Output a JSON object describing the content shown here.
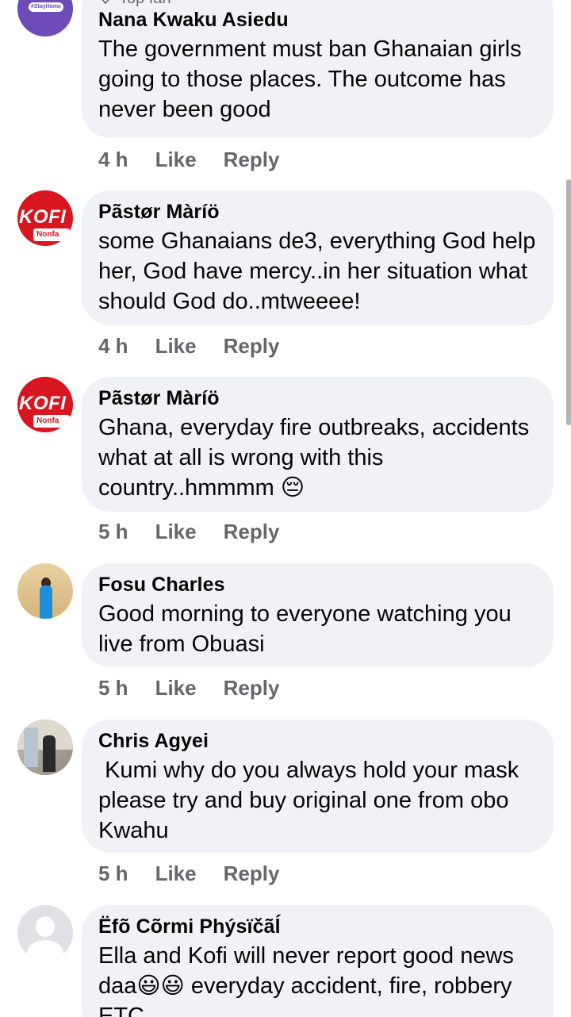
{
  "comments": [
    {
      "badge": "Top fan",
      "author": "Nana Kwaku Asiedu",
      "text": "The government must ban Ghanaian girls going to those places. The outcome has never been good",
      "time": "4 h",
      "like": "Like",
      "reply": "Reply",
      "avatar_text": "#StayHome"
    },
    {
      "author": "Pãstør Màríö",
      "text": "some Ghanaians de3, everything God help her, God have mercy..in her situation what should God do..mtweeee!",
      "time": "4 h",
      "like": "Like",
      "reply": "Reply",
      "avatar_text": "KOFI",
      "avatar_sub": "Nonfa"
    },
    {
      "author": "Pãstør Màríö",
      "text": "Ghana, everyday fire outbreaks, accidents what at all is wrong with this country..hmmmm 😔",
      "time": "5 h",
      "like": "Like",
      "reply": "Reply",
      "avatar_text": "KOFI",
      "avatar_sub": "Nonfa"
    },
    {
      "author": "Fosu Charles",
      "text": "Good morning to everyone watching you live from Obuasi",
      "time": "5 h",
      "like": "Like",
      "reply": "Reply"
    },
    {
      "author": "Chris Agyei",
      "text": " Kumi why do you always hold your mask please try and buy original one from obo Kwahu",
      "time": "5 h",
      "like": "Like",
      "reply": "Reply"
    },
    {
      "author": "Ëfõ Cõrmi Phýsïčãĺ",
      "text": "Ella and Kofi will never report good news daa😃😃 everyday accident, fire, robbery ETC",
      "time": "",
      "like": "",
      "reply": ""
    }
  ],
  "colors": {
    "bubble": "#f0f2f5",
    "meta": "#65676b",
    "text": "#050505",
    "kofi_red": "#d9151f"
  }
}
